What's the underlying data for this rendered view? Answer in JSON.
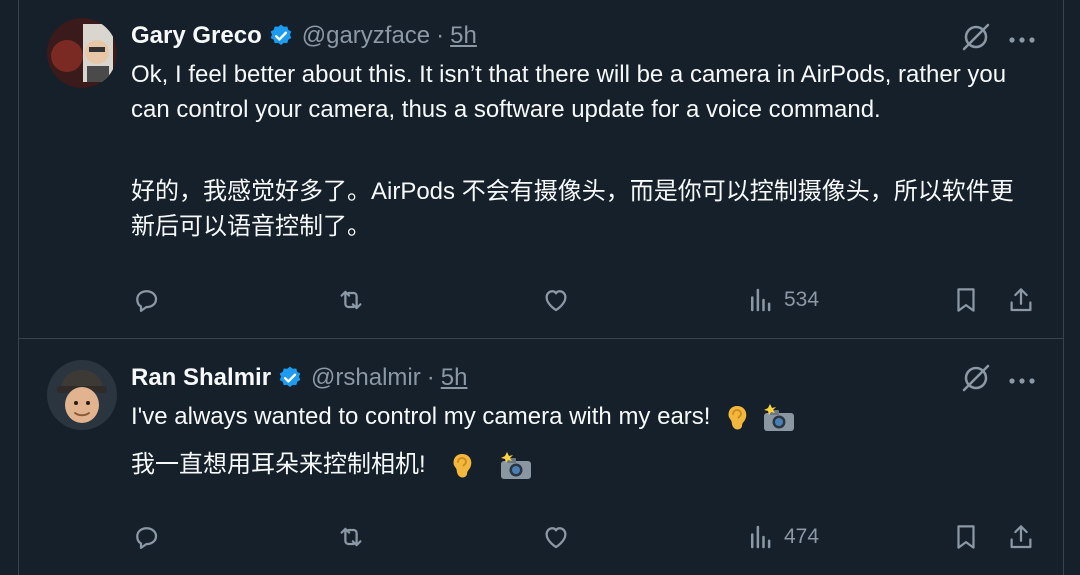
{
  "colors": {
    "background": "#15202b",
    "text_primary": "#f7f9f9",
    "text_secondary": "#8b98a5",
    "divider": "#38444d",
    "verified": "#1d9bf0"
  },
  "tweets": [
    {
      "name": "Gary Greco",
      "handle": "@garyzface",
      "separator": "·",
      "time": "5h",
      "text_en": "Ok, I feel better about this. It isn’t that there will be a camera in AirPods, rather you can control your camera, thus a software update for a voice command.",
      "text_zh": "好的，我感觉好多了。AirPods 不会有摄像头，而是你可以控制摄像头，所以软件更新后可以语音控制了。",
      "views": "534",
      "icons": [
        "verified-badge-icon",
        "grok-icon",
        "more-icon",
        "reply-icon",
        "repost-icon",
        "like-icon",
        "views-icon",
        "bookmark-icon",
        "share-icon"
      ]
    },
    {
      "name": "Ran Shalmir",
      "handle": "@rshalmir",
      "separator": "·",
      "time": "5h",
      "text_en": "I've always wanted to control my camera with my ears!",
      "text_zh": "我一直想用耳朵来控制相机!",
      "emojis": [
        "ear-emoji",
        "camera-flash-emoji"
      ],
      "views": "474",
      "icons": [
        "verified-badge-icon",
        "grok-icon",
        "more-icon",
        "reply-icon",
        "repost-icon",
        "like-icon",
        "views-icon",
        "bookmark-icon",
        "share-icon"
      ]
    }
  ]
}
